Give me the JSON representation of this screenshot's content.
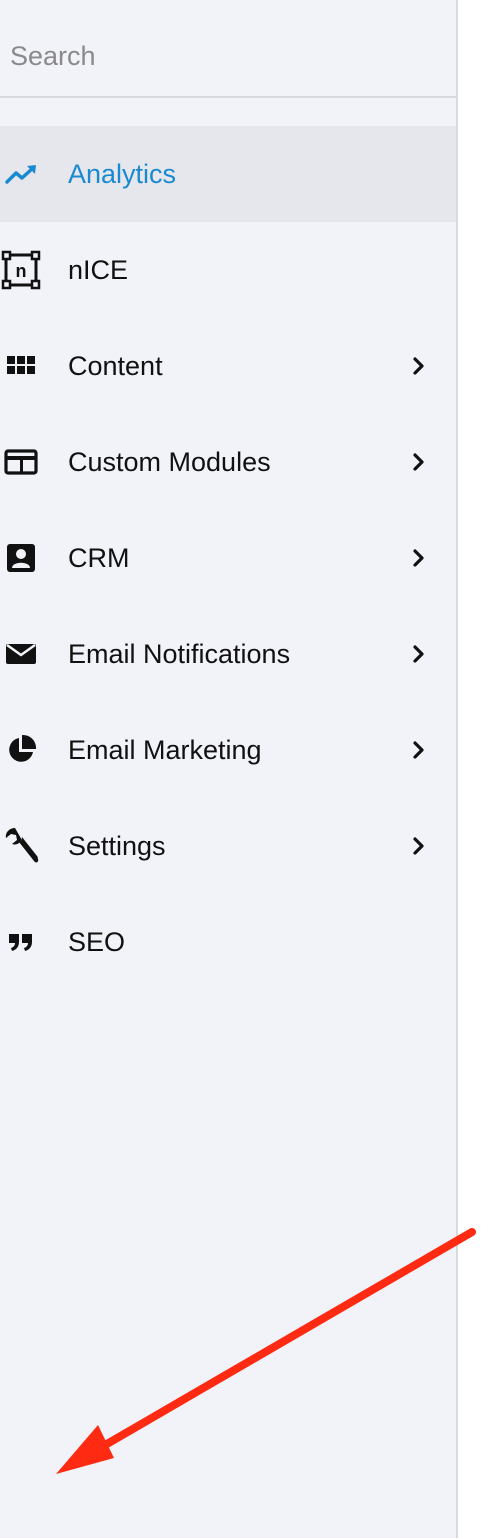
{
  "search": {
    "placeholder": "Search",
    "value": ""
  },
  "sidebar": {
    "active_color": "#1a8ad0",
    "items": [
      {
        "label": "Analytics",
        "icon": "trending-up-icon",
        "active": true,
        "has_submenu": false
      },
      {
        "label": "nICE",
        "icon": "nice-bracket-icon",
        "active": false,
        "has_submenu": false
      },
      {
        "label": "Content",
        "icon": "grid-icon",
        "active": false,
        "has_submenu": true
      },
      {
        "label": "Custom Modules",
        "icon": "module-window-icon",
        "active": false,
        "has_submenu": true
      },
      {
        "label": "CRM",
        "icon": "contact-card-icon",
        "active": false,
        "has_submenu": true
      },
      {
        "label": "Email Notifications",
        "icon": "envelope-icon",
        "active": false,
        "has_submenu": true
      },
      {
        "label": "Email Marketing",
        "icon": "pie-chart-icon",
        "active": false,
        "has_submenu": true
      },
      {
        "label": "Settings",
        "icon": "wrench-icon",
        "active": false,
        "has_submenu": true
      },
      {
        "label": "SEO",
        "icon": "quote-icon",
        "active": false,
        "has_submenu": false
      }
    ]
  },
  "annotation": {
    "arrow_color": "#ff2a12",
    "icon": "red-arrow-icon"
  }
}
